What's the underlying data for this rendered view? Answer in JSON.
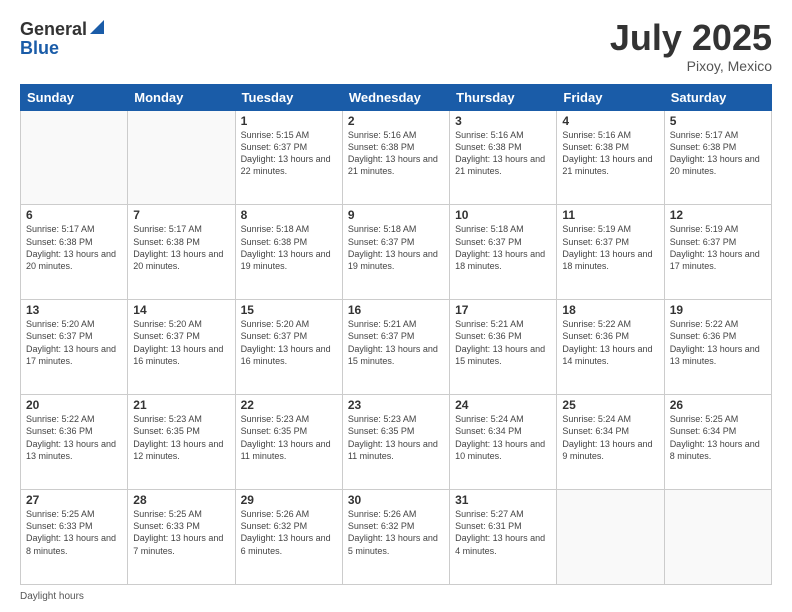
{
  "header": {
    "logo_general": "General",
    "logo_blue": "Blue",
    "title_month": "July 2025",
    "title_location": "Pixoy, Mexico"
  },
  "calendar": {
    "days_of_week": [
      "Sunday",
      "Monday",
      "Tuesday",
      "Wednesday",
      "Thursday",
      "Friday",
      "Saturday"
    ],
    "weeks": [
      [
        {
          "day": "",
          "sunrise": "",
          "sunset": "",
          "daylight": ""
        },
        {
          "day": "",
          "sunrise": "",
          "sunset": "",
          "daylight": ""
        },
        {
          "day": "1",
          "sunrise": "Sunrise: 5:15 AM",
          "sunset": "Sunset: 6:37 PM",
          "daylight": "Daylight: 13 hours and 22 minutes."
        },
        {
          "day": "2",
          "sunrise": "Sunrise: 5:16 AM",
          "sunset": "Sunset: 6:38 PM",
          "daylight": "Daylight: 13 hours and 21 minutes."
        },
        {
          "day": "3",
          "sunrise": "Sunrise: 5:16 AM",
          "sunset": "Sunset: 6:38 PM",
          "daylight": "Daylight: 13 hours and 21 minutes."
        },
        {
          "day": "4",
          "sunrise": "Sunrise: 5:16 AM",
          "sunset": "Sunset: 6:38 PM",
          "daylight": "Daylight: 13 hours and 21 minutes."
        },
        {
          "day": "5",
          "sunrise": "Sunrise: 5:17 AM",
          "sunset": "Sunset: 6:38 PM",
          "daylight": "Daylight: 13 hours and 20 minutes."
        }
      ],
      [
        {
          "day": "6",
          "sunrise": "Sunrise: 5:17 AM",
          "sunset": "Sunset: 6:38 PM",
          "daylight": "Daylight: 13 hours and 20 minutes."
        },
        {
          "day": "7",
          "sunrise": "Sunrise: 5:17 AM",
          "sunset": "Sunset: 6:38 PM",
          "daylight": "Daylight: 13 hours and 20 minutes."
        },
        {
          "day": "8",
          "sunrise": "Sunrise: 5:18 AM",
          "sunset": "Sunset: 6:38 PM",
          "daylight": "Daylight: 13 hours and 19 minutes."
        },
        {
          "day": "9",
          "sunrise": "Sunrise: 5:18 AM",
          "sunset": "Sunset: 6:37 PM",
          "daylight": "Daylight: 13 hours and 19 minutes."
        },
        {
          "day": "10",
          "sunrise": "Sunrise: 5:18 AM",
          "sunset": "Sunset: 6:37 PM",
          "daylight": "Daylight: 13 hours and 18 minutes."
        },
        {
          "day": "11",
          "sunrise": "Sunrise: 5:19 AM",
          "sunset": "Sunset: 6:37 PM",
          "daylight": "Daylight: 13 hours and 18 minutes."
        },
        {
          "day": "12",
          "sunrise": "Sunrise: 5:19 AM",
          "sunset": "Sunset: 6:37 PM",
          "daylight": "Daylight: 13 hours and 17 minutes."
        }
      ],
      [
        {
          "day": "13",
          "sunrise": "Sunrise: 5:20 AM",
          "sunset": "Sunset: 6:37 PM",
          "daylight": "Daylight: 13 hours and 17 minutes."
        },
        {
          "day": "14",
          "sunrise": "Sunrise: 5:20 AM",
          "sunset": "Sunset: 6:37 PM",
          "daylight": "Daylight: 13 hours and 16 minutes."
        },
        {
          "day": "15",
          "sunrise": "Sunrise: 5:20 AM",
          "sunset": "Sunset: 6:37 PM",
          "daylight": "Daylight: 13 hours and 16 minutes."
        },
        {
          "day": "16",
          "sunrise": "Sunrise: 5:21 AM",
          "sunset": "Sunset: 6:37 PM",
          "daylight": "Daylight: 13 hours and 15 minutes."
        },
        {
          "day": "17",
          "sunrise": "Sunrise: 5:21 AM",
          "sunset": "Sunset: 6:36 PM",
          "daylight": "Daylight: 13 hours and 15 minutes."
        },
        {
          "day": "18",
          "sunrise": "Sunrise: 5:22 AM",
          "sunset": "Sunset: 6:36 PM",
          "daylight": "Daylight: 13 hours and 14 minutes."
        },
        {
          "day": "19",
          "sunrise": "Sunrise: 5:22 AM",
          "sunset": "Sunset: 6:36 PM",
          "daylight": "Daylight: 13 hours and 13 minutes."
        }
      ],
      [
        {
          "day": "20",
          "sunrise": "Sunrise: 5:22 AM",
          "sunset": "Sunset: 6:36 PM",
          "daylight": "Daylight: 13 hours and 13 minutes."
        },
        {
          "day": "21",
          "sunrise": "Sunrise: 5:23 AM",
          "sunset": "Sunset: 6:35 PM",
          "daylight": "Daylight: 13 hours and 12 minutes."
        },
        {
          "day": "22",
          "sunrise": "Sunrise: 5:23 AM",
          "sunset": "Sunset: 6:35 PM",
          "daylight": "Daylight: 13 hours and 11 minutes."
        },
        {
          "day": "23",
          "sunrise": "Sunrise: 5:23 AM",
          "sunset": "Sunset: 6:35 PM",
          "daylight": "Daylight: 13 hours and 11 minutes."
        },
        {
          "day": "24",
          "sunrise": "Sunrise: 5:24 AM",
          "sunset": "Sunset: 6:34 PM",
          "daylight": "Daylight: 13 hours and 10 minutes."
        },
        {
          "day": "25",
          "sunrise": "Sunrise: 5:24 AM",
          "sunset": "Sunset: 6:34 PM",
          "daylight": "Daylight: 13 hours and 9 minutes."
        },
        {
          "day": "26",
          "sunrise": "Sunrise: 5:25 AM",
          "sunset": "Sunset: 6:34 PM",
          "daylight": "Daylight: 13 hours and 8 minutes."
        }
      ],
      [
        {
          "day": "27",
          "sunrise": "Sunrise: 5:25 AM",
          "sunset": "Sunset: 6:33 PM",
          "daylight": "Daylight: 13 hours and 8 minutes."
        },
        {
          "day": "28",
          "sunrise": "Sunrise: 5:25 AM",
          "sunset": "Sunset: 6:33 PM",
          "daylight": "Daylight: 13 hours and 7 minutes."
        },
        {
          "day": "29",
          "sunrise": "Sunrise: 5:26 AM",
          "sunset": "Sunset: 6:32 PM",
          "daylight": "Daylight: 13 hours and 6 minutes."
        },
        {
          "day": "30",
          "sunrise": "Sunrise: 5:26 AM",
          "sunset": "Sunset: 6:32 PM",
          "daylight": "Daylight: 13 hours and 5 minutes."
        },
        {
          "day": "31",
          "sunrise": "Sunrise: 5:27 AM",
          "sunset": "Sunset: 6:31 PM",
          "daylight": "Daylight: 13 hours and 4 minutes."
        },
        {
          "day": "",
          "sunrise": "",
          "sunset": "",
          "daylight": ""
        },
        {
          "day": "",
          "sunrise": "",
          "sunset": "",
          "daylight": ""
        }
      ]
    ]
  },
  "footer": {
    "daylight_label": "Daylight hours"
  }
}
